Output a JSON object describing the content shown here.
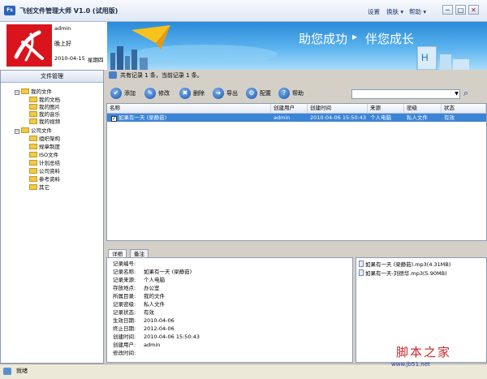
{
  "window": {
    "icon_text": "Fs",
    "title": "飞创文件管理大师 V1.0 (试用版)",
    "menu": [
      "设置",
      "换肤 ▾",
      "帮助 ▾"
    ],
    "controls": [
      "─",
      "□",
      "✕"
    ]
  },
  "header": {
    "user": "admin",
    "greeting": "晚上好",
    "date": "2010-04-15",
    "weekday": "星期四",
    "slogan_left": "助您成功",
    "slogan_right": "伴您成长"
  },
  "sidebar": {
    "title": "文件管理",
    "my_files": {
      "label": "我的文件",
      "children": [
        "我的文档",
        "我的图片",
        "我的音乐",
        "我的视频"
      ]
    },
    "public_files": {
      "label": "公司文件",
      "children": [
        "组织架构",
        "规章制度",
        "ISO文件",
        "计划总结",
        "公司资料",
        "参考资料",
        "其它"
      ]
    }
  },
  "infobar": {
    "text": "共有记录 1 条，当前记录 1 条。"
  },
  "toolbar": {
    "buttons": [
      {
        "label": "添加",
        "icon": "check-icon",
        "glyph": "✔"
      },
      {
        "label": "修改",
        "icon": "edit-icon",
        "glyph": "✎"
      },
      {
        "label": "删除",
        "icon": "delete-icon",
        "glyph": "✖"
      },
      {
        "label": "导出",
        "icon": "export-icon",
        "glyph": "➜"
      },
      {
        "label": "配置",
        "icon": "config-icon",
        "glyph": "⚙"
      },
      {
        "label": "帮助",
        "icon": "help-icon",
        "glyph": "?"
      }
    ],
    "search_value": ""
  },
  "grid": {
    "columns": [
      "名称",
      "创建用户",
      "创建时间",
      "来源",
      "密级",
      "状态"
    ],
    "rows": [
      {
        "checked": true,
        "name": "如果有一天 (梁静茹)",
        "user": "admin",
        "time": "2010-04-06 15:50:43",
        "source": "个人电脑",
        "level": "私人文件",
        "status": "有效"
      }
    ]
  },
  "detail": {
    "tabs": [
      "详细",
      "备注"
    ],
    "fields": [
      {
        "label": "记录编号:",
        "value": ""
      },
      {
        "label": "记录名称:",
        "value": "如果有一天 (梁静茹)"
      },
      {
        "label": "记录来源:",
        "value": "个人电脑"
      },
      {
        "label": "存放地点:",
        "value": "办公室"
      },
      {
        "label": "所属目录:",
        "value": "我的文件"
      },
      {
        "label": "记录密级:",
        "value": "私人文件"
      },
      {
        "label": "记录状态:",
        "value": "有效"
      },
      {
        "label": "生效日期:",
        "value": "2010-04-06"
      },
      {
        "label": "终止日期:",
        "value": "2012-04-06"
      },
      {
        "label": "创建时间:",
        "value": "2010-04-06 15:50:43"
      },
      {
        "label": "创建用户:",
        "value": "admin"
      },
      {
        "label": "修改时间:",
        "value": ""
      }
    ]
  },
  "attachments": [
    "如果有一天 (梁静茹).mp3(4.31MB)",
    "如果有一天-刘德华.mp3(5.90MB)"
  ],
  "status": {
    "text": "就绪"
  },
  "watermark": {
    "cn": "脚本之家",
    "url": "www.jb51.net"
  },
  "colors": {
    "selection": "#3c84d6",
    "logo_red": "#d9141c",
    "banner_blue": "#2a8ad8"
  }
}
